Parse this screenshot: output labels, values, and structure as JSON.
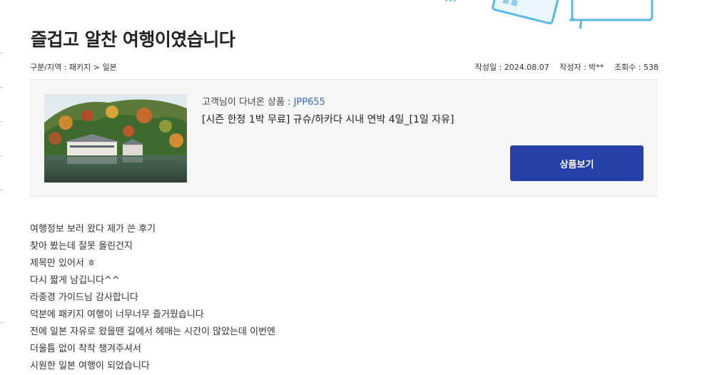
{
  "post": {
    "title": "즐겁고 알찬 여행이였습니다",
    "category": "구분/지역 : 패키지 > 일본",
    "date_label": "작성일 : 2024.08.07",
    "author_label": "작성자 : 박**",
    "views_label": "조회수 : 538"
  },
  "product": {
    "label_prefix": "고객님이 다녀온 상품 : ",
    "code": "JPP655",
    "name": "[시즌 한정 1박 무료] 규슈/하카다 시내 연박 4일_[1일 자유]",
    "button_label": "상품보기"
  },
  "review_lines": [
    "여행정보 보러 왔다 제가 쓴 후기",
    "찾아 봤는데 잘못 올린건지",
    "제목만 있어서 ㅎ",
    "다시 짧게 남깁니다^^",
    "라종경 가이드님 감사합니다",
    "덕분에 패키지 여행이 너무너무 즐거웠습니다",
    "전에 일본 자유로 왔을땐 길에서 헤매는 시간이 많았는데 이번엔",
    "더울틈 없이 착착 챙겨주셔서",
    "시원한 일본 여행이 되었습니다"
  ],
  "colors": {
    "accent_button": "#2540a8",
    "link_code": "#2d6fd0",
    "box_bg": "#f6f6f6"
  }
}
